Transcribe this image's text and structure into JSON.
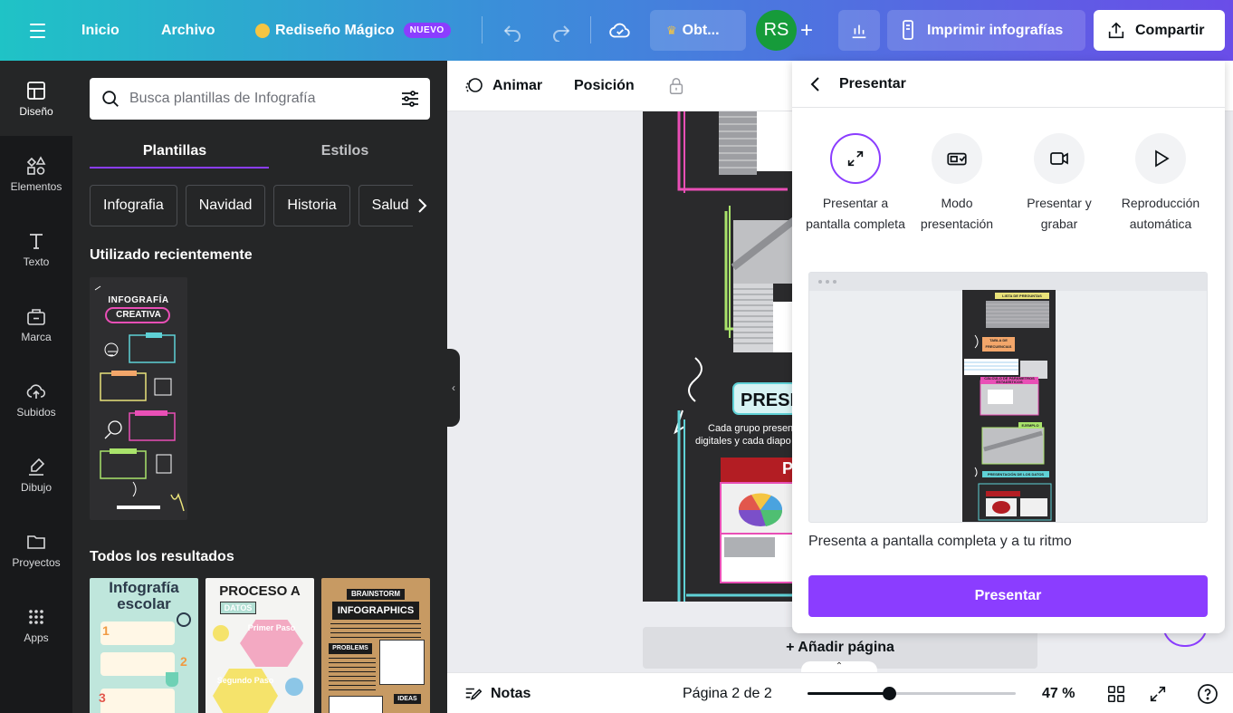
{
  "topbar": {
    "home": "Inicio",
    "file": "Archivo",
    "magic": "Rediseño Mágico",
    "magic_badge": "NUEVO",
    "upgrade": "Obt...",
    "avatar_initials": "RS",
    "print": "Imprimir infografías",
    "share": "Compartir"
  },
  "rail": [
    {
      "label": "Diseño",
      "icon": "layout-icon"
    },
    {
      "label": "Elementos",
      "icon": "shapes-icon"
    },
    {
      "label": "Texto",
      "icon": "text-icon"
    },
    {
      "label": "Marca",
      "icon": "brand-icon"
    },
    {
      "label": "Subidos",
      "icon": "upload-cloud-icon"
    },
    {
      "label": "Dibujo",
      "icon": "draw-icon"
    },
    {
      "label": "Proyectos",
      "icon": "folder-icon"
    },
    {
      "label": "Apps",
      "icon": "apps-grid-icon"
    }
  ],
  "panel": {
    "search_placeholder": "Busca plantillas de Infografía",
    "tabs": [
      "Plantillas",
      "Estilos"
    ],
    "chips": [
      "Infografia",
      "Navidad",
      "Historia",
      "Salud"
    ],
    "recent_title": "Utilizado recientemente",
    "all_title": "Todos los resultados",
    "recent_thumb": {
      "line1": "INFOGRAFÍA",
      "line2": "CREATIVA"
    },
    "results": [
      {
        "title": "Infografía escolar"
      },
      {
        "title": "PROCESO A",
        "subtitle": "DATOS",
        "step1": "Primer Paso",
        "step2": "Segundo Paso"
      },
      {
        "title": "BRAINSTORM",
        "subtitle": "INFOGRAPHICS",
        "tag1": "PROBLEMS",
        "tag2": "IDEAS"
      }
    ]
  },
  "context_bar": {
    "animate": "Animar",
    "position": "Posición"
  },
  "canvas": {
    "heading": "PRESE",
    "caption1": "Cada grupo present",
    "caption2": "digitales y cada diapo",
    "letter": "P"
  },
  "add_page": "+ Añadir página",
  "bottom": {
    "notes": "Notas",
    "page": "Página 2 de 2",
    "zoom": "47 %",
    "zoom_fraction": 0.39
  },
  "present": {
    "title": "Presentar",
    "options": [
      {
        "label": "Presentar a pantalla completa",
        "icon": "expand-arrows-icon",
        "selected": true
      },
      {
        "label": "Modo presentación",
        "icon": "presenter-mode-icon",
        "selected": false
      },
      {
        "label": "Presentar y grabar",
        "icon": "video-camera-icon",
        "selected": false
      },
      {
        "label": "Reproducción automática",
        "icon": "play-icon",
        "selected": false
      }
    ],
    "preview_labels": [
      "LISTA DE PREGUNTAS",
      "TABLA DE FRECUENCIAS",
      "CÁLCULO DE PARÁMETROS ESTADÍSTICOS",
      "EJEMPLO",
      "PRESENTACIÓN DE LOS DATOS"
    ],
    "description": "Presenta a pantalla completa y a tu ritmo",
    "button": "Presentar"
  },
  "colors": {
    "accent": "#8b3dff",
    "rail_bg": "#18191b",
    "panel_bg": "#252627",
    "avatar": "#169b3a"
  }
}
